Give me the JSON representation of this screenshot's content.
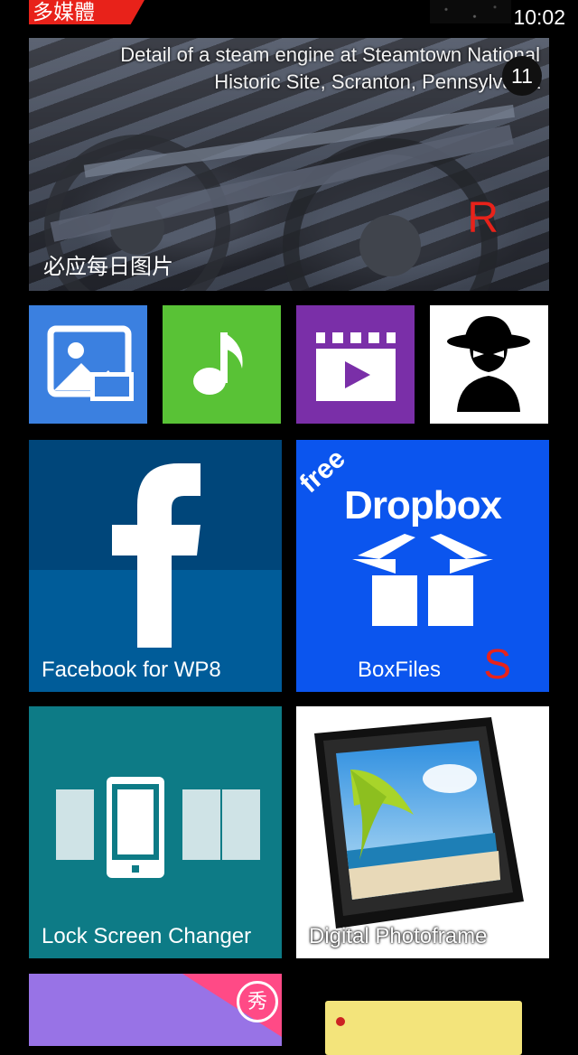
{
  "statusbar": {
    "category": "多媒體",
    "time": "10:02"
  },
  "bing_tile": {
    "caption": "Detail of a steam engine at Steamtown National Historic Site, Scranton, Pennsylvania",
    "badge_count": "11",
    "overlay_letter": "R",
    "label": "必应每日图片"
  },
  "small_tiles": [
    {
      "name": "photos-video",
      "icon": "photo-video-icon",
      "color": "#3b80e0"
    },
    {
      "name": "music",
      "icon": "music-note-icon",
      "color": "#59c236"
    },
    {
      "name": "video",
      "icon": "clapperboard-icon",
      "color": "#7a2fa8"
    },
    {
      "name": "incognito",
      "icon": "spy-icon",
      "color": "#ffffff"
    }
  ],
  "facebook_tile": {
    "label": "Facebook for WP8",
    "icon": "facebook-f-icon",
    "color": "#005c99"
  },
  "dropbox_tile": {
    "free_text": "free",
    "brand": "Dropbox",
    "label": "BoxFiles",
    "overlay_letter": "S",
    "icon": "open-box-icon",
    "color": "#0b55ee"
  },
  "lockscreen_tile": {
    "label": "Lock Screen Changer",
    "icon": "phone-cards-icon",
    "color": "#0d7b86"
  },
  "photoframe_tile": {
    "label": "Digital Photoframe",
    "icon": "photo-frame-icon"
  },
  "meitu_tile": {
    "badge": "秀",
    "color": "#9873e6"
  },
  "notes_tile": {
    "icon": "sticky-note-icon",
    "color": "#f3e47b"
  }
}
